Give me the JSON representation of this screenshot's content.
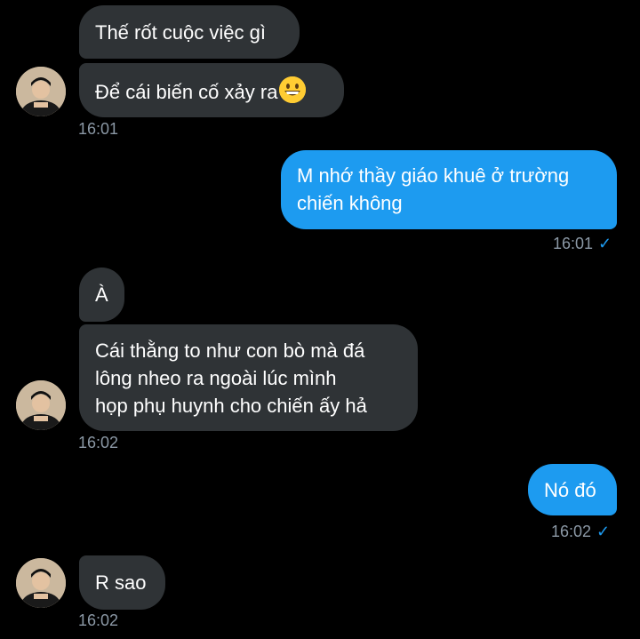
{
  "messages": [
    {
      "id": "m1",
      "dir": "in",
      "text": "Thế rốt cuộc việc gì"
    },
    {
      "id": "m2",
      "dir": "in",
      "text": "Để cái biến cố xảy ra",
      "emoji": "grinning-face-emoji",
      "time": "16:01"
    },
    {
      "id": "m3",
      "dir": "out",
      "lines": [
        "M nhớ thầy giáo khuê ở trường",
        "chiến không"
      ],
      "time": "16:01"
    },
    {
      "id": "m4",
      "dir": "in",
      "text": "À"
    },
    {
      "id": "m5",
      "dir": "in",
      "lines": [
        "Cái thằng to như con bò mà đá",
        "lông nheo ra ngoài lúc mình",
        "họp phụ huynh cho chiến ấy hả"
      ],
      "time": "16:02"
    },
    {
      "id": "m6",
      "dir": "out",
      "text": "Nó đó",
      "time": "16:02"
    },
    {
      "id": "m7",
      "dir": "in",
      "text": "R sao",
      "time": "16:02"
    }
  ],
  "read_icon": "check-icon",
  "colors": {
    "incoming": "#2f3336",
    "outgoing": "#1d9bf0",
    "timestamp": "#8b98a5",
    "background": "#000000"
  }
}
